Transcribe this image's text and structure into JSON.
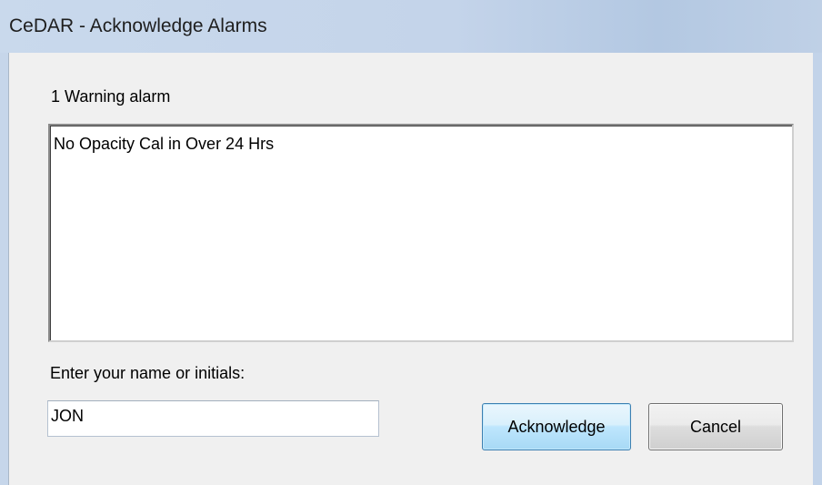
{
  "window": {
    "title": "CeDAR - Acknowledge Alarms"
  },
  "alarms": {
    "summary_label": "1 Warning alarm",
    "items": [
      "No Opacity Cal in Over 24 Hrs"
    ]
  },
  "name_entry": {
    "label": "Enter your name or initials:",
    "value": "JON"
  },
  "buttons": {
    "acknowledge_label": "Acknowledge",
    "cancel_label": "Cancel"
  },
  "colors": {
    "titlebar": "#c4d4ea",
    "dialog_background": "#f0f0f0",
    "default_button_border": "#3c7fb1"
  }
}
